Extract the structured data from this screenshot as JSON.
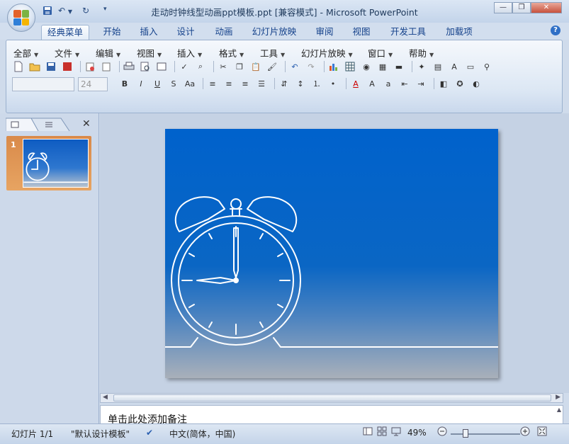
{
  "window": {
    "title": "走动时钟线型动画ppt模板.ppt [兼容模式] - Microsoft PowerPoint",
    "minimize": "—",
    "restore": "❐",
    "close": "✕"
  },
  "tabs": [
    "经典菜单",
    "开始",
    "插入",
    "设计",
    "动画",
    "幻灯片放映",
    "审阅",
    "视图",
    "开发工具",
    "加载项"
  ],
  "menus": [
    "全部",
    "文件",
    "编辑",
    "视图",
    "插入",
    "格式",
    "工具",
    "幻灯片放映",
    "窗口",
    "帮助"
  ],
  "font": {
    "name": "",
    "size": "24"
  },
  "format_buttons": {
    "bold": "B",
    "italic": "I",
    "underline": "U",
    "shadow": "S",
    "case": "Aa"
  },
  "slide_pane": {
    "slide_number": "1",
    "close": "✕"
  },
  "notes": {
    "placeholder": "单击此处添加备注"
  },
  "status": {
    "slide": "幻灯片 1/1",
    "theme": "\"默认设计模板\"",
    "language": "中文(简体，中国)",
    "zoom": "49%"
  },
  "colors": {
    "slide_top": "#0062cc",
    "slide_bottom": "#a9b0ba",
    "accent": "#15428b"
  }
}
